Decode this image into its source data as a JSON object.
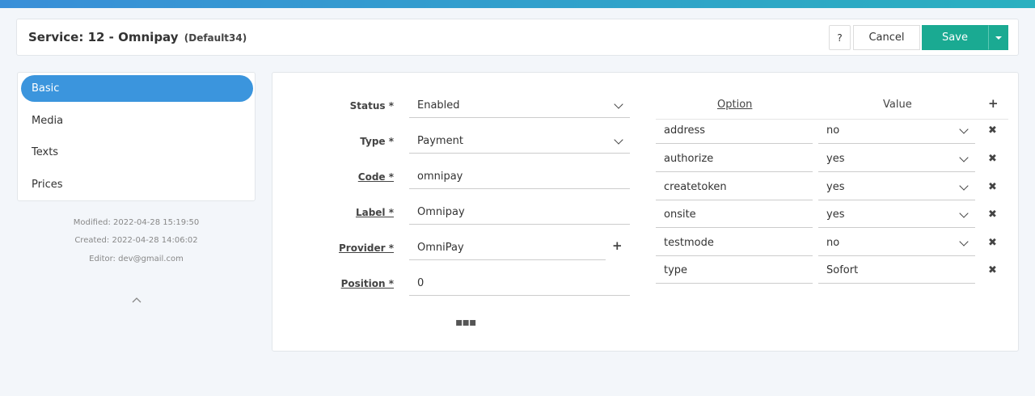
{
  "header": {
    "title": "Service: 12 - Omnipay",
    "subtitle": "(Default34)",
    "help_label": "?",
    "cancel_label": "Cancel",
    "save_label": "Save"
  },
  "nav": {
    "items": [
      {
        "label": "Basic",
        "active": true
      },
      {
        "label": "Media",
        "active": false
      },
      {
        "label": "Texts",
        "active": false
      },
      {
        "label": "Prices",
        "active": false
      }
    ]
  },
  "meta": {
    "modified": "Modified: 2022-04-28 15:19:50",
    "created": "Created: 2022-04-28 14:06:02",
    "editor": "Editor: dev@gmail.com"
  },
  "form": {
    "status_label": "Status *",
    "status_value": "Enabled",
    "type_label": "Type *",
    "type_value": "Payment",
    "code_label": "Code *",
    "code_value": "omnipay",
    "label_label": "Label *",
    "label_value": "Omnipay",
    "provider_label": "Provider *",
    "provider_value": "OmniPay",
    "position_label": "Position *",
    "position_value": "0",
    "more": "▪▪▪"
  },
  "options": {
    "option_header": "Option",
    "value_header": "Value",
    "rows": [
      {
        "key": "address",
        "value": "no"
      },
      {
        "key": "authorize",
        "value": "yes"
      },
      {
        "key": "createtoken",
        "value": "yes"
      },
      {
        "key": "onsite",
        "value": "yes"
      },
      {
        "key": "testmode",
        "value": "no"
      },
      {
        "key": "type",
        "value": "Sofort"
      }
    ]
  },
  "icons": {
    "add": "plus-icon",
    "remove": "close-icon",
    "dropdown": "chevron-down-icon",
    "collapse": "chevron-up-icon"
  },
  "colors": {
    "primary": "#3b95dd",
    "save": "#1aaa92"
  }
}
